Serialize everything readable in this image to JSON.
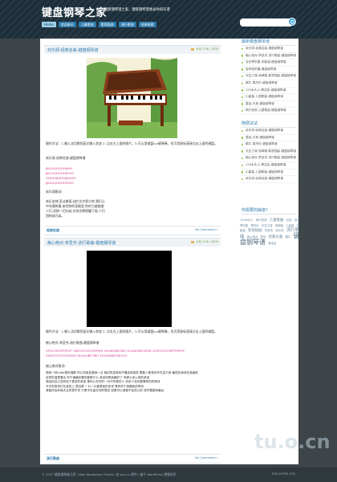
{
  "header": {
    "title": "键盘钢琴之家",
    "description": "键盘钢琴谱之家，键盘钢琴谱收录你的乐谱",
    "nav": [
      "Home",
      "欢迎来访",
      "儿童歌曲",
      "影视插曲",
      "流行歌曲",
      "经典老歌"
    ]
  },
  "content": {
    "pages": "Pages: 1 2 3 4 5 Next",
    "post1": {
      "title": "欢乐颂-经典名曲-键盘钢琴谱",
      "meta": "七月 17th, 2009",
      "intro": "操作方法：1.输入法切换到英文输入状态 2. 点击左上面的图片，3.可以用键盘a-z键弹奏，也可用鼠标直接点击上面的键盘。",
      "song": "欢乐颂-经典名曲-键盘钢琴谱",
      "keys": [
        "JJKLLKJHGGHJJHH",
        "JJKLLKJHGGHJHGG",
        "HHJGHJKJGHJKJHGH",
        "JJKLLKJHGGHJHGG"
      ],
      "title2": "欢乐颂歌词:",
      "lyrics": "欢乐女神,圣洁美丽,灿烂光芒照大地.我们心中充满热情,来到你的圣殿里.你的力量能使人们,消除一切分歧,在你光辉照耀下面,人们团结成兄弟。",
      "foot_left": "经典名曲",
      "foot_right": "No Comments »"
    },
    "post2": {
      "title": "痴心绝对-李圣杰-流行歌曲-键盘钢琴谱",
      "meta": "七月 17th, 2009",
      "intro": "操作方法：1.输入法切换到英文输入状态 2. 点击左上面的图片，3.可以用键盘a-z键弹奏，也可用鼠标直接点击上面的键盘。",
      "song": "痴心绝对-李圣杰-流行歌曲-键盘钢琴谱",
      "keys": [
        "OPUUOIOIPOPUP OIKOOOOOOHHHJH HLHAHBEOBO HLHAHBEOBOB OOPOOOIOJPPOPPSP",
        "OIKOOOOOOHHHJH HLHAHBEOBO HLHAHBEOBOOO"
      ],
      "title2": "痴心绝对歌词:",
      "lyrics": [
        "想用一杯Latte把你灌醉 好让你能多爱我一点 暗恋的滋味你不懂这种感觉 果敢人是真的坏在这只身 最孤的身体在我面前",
        "这样的温柔要出 你千遍最你要的都是什么 我该说是我最好了 有那么多心底的承诺",
        "我给你自己没有给于更多的承诺 像你心在伤的一对不完美的人 你多少没有爱情悲伤的等待",
        "冷冷的夜风打在我的上 是否那 一片一片都是我的未来 等你终于读懂我的等待",
        "我能体会你每天过的很不安 只是不去留在你的想念 如果可以谁都不会担心的 或许要爱到最后"
      ],
      "foot_left": "流行歌曲",
      "foot_right": "No Comments »"
    }
  },
  "sidebar": {
    "recent_title": "最新键盘钢琴谱",
    "recent": [
      "欢乐颂-经典名曲-键盘钢琴谱",
      "痴心绝对-李圣杰-流行歌曲-键盘钢琴谱",
      "全世界的爱-张韶涵-键盘钢琴谱",
      "会呼吸的痛-键盘钢琴谱",
      "天空之城-宫崎骏-影视插曲-键盘钢琴谱",
      "蜗牛-周杰伦-键盘钢琴谱",
      "123木头人-黑涩会-键盘钢琴谱",
      "小星星-儿童歌曲-键盘钢琴谱",
      "童话-光良-键盘钢琴谱",
      "两只老虎-儿童歌曲-键盘钢琴谱"
    ],
    "random_title": "随便试试",
    "random": [
      "欢乐颂-经典名曲-键盘钢琴谱",
      "童话-光良-键盘钢琴谱",
      "蜗牛-周杰伦-键盘钢琴谱",
      "天空之城-宫崎骏-影视插曲-键盘钢琴谱",
      "痴心绝对-李圣杰-流行歌曲-键盘钢琴谱",
      "123木头人-黑涩会-键盘钢琴谱",
      "小星星-儿童歌曲-键盘钢琴谱",
      "欢乐颂-经典名曲-键盘钢琴谱"
    ],
    "tags_title": "你需要的曲谱?",
    "tags": [
      "123木头人",
      "两只老虎",
      "儿童歌曲",
      "光良",
      "全世界的爱",
      "周杰伦",
      "天空之城",
      "宫崎骏",
      "小星星",
      "张韶涵",
      "影视插曲",
      "李圣杰",
      "欢乐颂",
      "流行歌曲",
      "痴心绝对",
      "童话",
      "经典名曲",
      "蜗牛",
      "键盘钢琴谱",
      "黑涩会"
    ]
  },
  "footer": {
    "left": "© 2007 键盘钢琴谱之家 | Wan Wordpress Theme, 由 yq1.cn 提供 | 基于 WordPress 博客程序",
    "right": "RSS   XHTML   CSS"
  },
  "watermark": "tu.o.cn"
}
